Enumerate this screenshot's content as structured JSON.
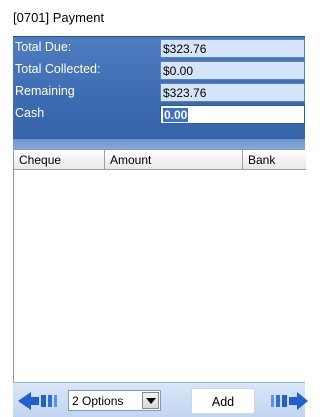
{
  "window": {
    "title": "[0701]  Payment"
  },
  "summary": {
    "rows": [
      {
        "label": "Total Due:",
        "value": "$323.76"
      },
      {
        "label": "Total Collected:",
        "value": "$0.00"
      },
      {
        "label": "Remaining",
        "value": "$323.76"
      },
      {
        "label": "Cash",
        "value": "0.00"
      }
    ]
  },
  "grid": {
    "columns": [
      "Cheque",
      "Amount",
      "Bank"
    ]
  },
  "bottom": {
    "options_value": "2 Options",
    "add_label": "Add"
  },
  "colors": {
    "panel_blue": "#3a6ab0",
    "value_bg": "#d6e4fa",
    "arrow_blue": "#1f5fd1"
  },
  "icons": {
    "nav_left": "arrow-left-icon",
    "nav_right": "arrow-right-icon",
    "dropdown": "chevron-down-icon"
  }
}
